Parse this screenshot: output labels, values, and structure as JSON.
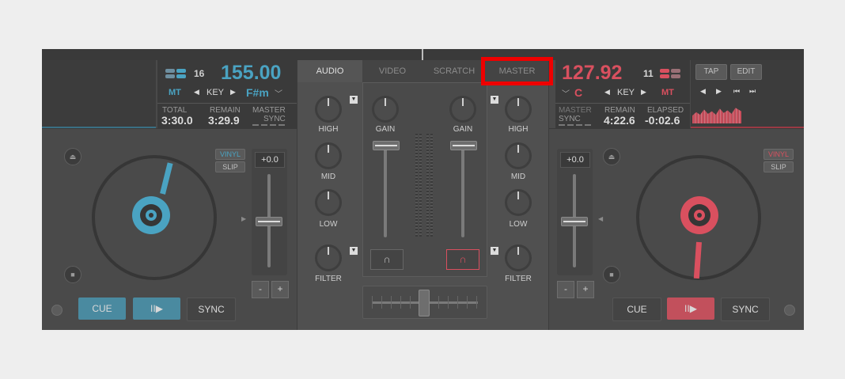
{
  "colors": {
    "left_accent": "#4aa3c2",
    "right_accent": "#d9505f",
    "highlight": "#ee0000"
  },
  "left_deck": {
    "bpm": "155.00",
    "beat_count": "16",
    "mt": "MT",
    "key_label": "KEY",
    "key_value": "F#m",
    "total_label": "TOTAL",
    "total_value": "3:30.0",
    "remain_label": "REMAIN",
    "remain_value": "3:29.9",
    "master_label": "MASTER",
    "sync_label": "SYNC",
    "vinyl": "VINYL",
    "slip": "SLIP",
    "pitch": "+0.0",
    "minus": "-",
    "plus": "+",
    "cue": "CUE",
    "play": "II▶",
    "sync": "SYNC"
  },
  "right_deck": {
    "bpm": "127.92",
    "beat_count": "11",
    "mt": "MT",
    "key_label": "KEY",
    "key_value": "C",
    "master_label": "MASTER",
    "sync_label": "SYNC",
    "remain_label": "REMAIN",
    "remain_value": "4:22.6",
    "elapsed_label": "ELAPSED",
    "elapsed_value": "-0:02.6",
    "tap": "TAP",
    "edit": "EDIT",
    "vinyl": "VINYL",
    "slip": "SLIP",
    "pitch": "+0.0",
    "minus": "-",
    "plus": "+",
    "cue": "CUE",
    "play": "II▶",
    "sync": "SYNC"
  },
  "mixer": {
    "tabs": [
      "AUDIO",
      "VIDEO",
      "SCRATCH",
      "MASTER"
    ],
    "high": "HIGH",
    "mid": "MID",
    "low": "LOW",
    "filter": "FILTER",
    "gain": "GAIN"
  }
}
